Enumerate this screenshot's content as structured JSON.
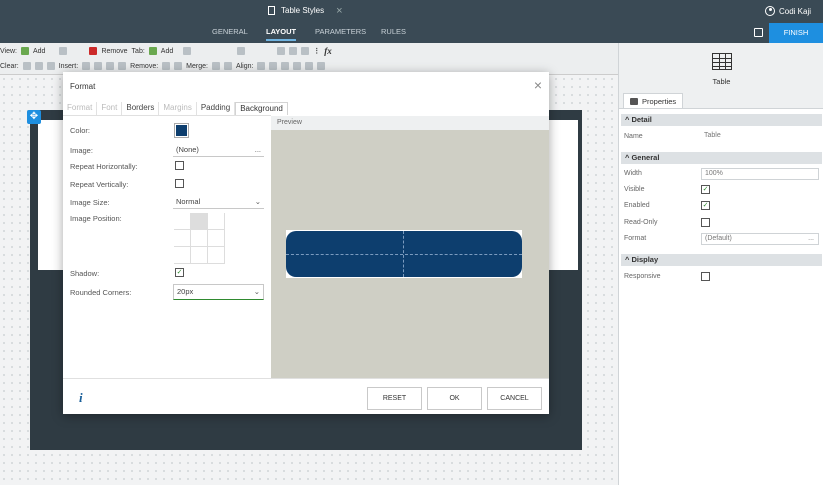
{
  "header": {
    "doc_title": "Table Styles",
    "user_name": "Codi Kaji",
    "tabs": [
      "GENERAL",
      "LAYOUT",
      "PARAMETERS",
      "RULES"
    ],
    "active_tab": "LAYOUT",
    "finish_label": "FINISH"
  },
  "toolbar": {
    "row1": {
      "view": "View:",
      "add": "Add",
      "remove": "Remove",
      "tab": "Tab:",
      "tab_add": "Add"
    },
    "row2": {
      "clear": "Clear:",
      "insert": "Insert:",
      "remove": "Remove:",
      "merge": "Merge:",
      "align": "Align:"
    }
  },
  "right_panel": {
    "control_label": "Table",
    "tab_label": "Properties",
    "sections": {
      "detail": "Detail",
      "general": "General",
      "display": "Display"
    },
    "properties": {
      "name_label": "Name",
      "name_value": "Table",
      "width_label": "Width",
      "width_value": "100%",
      "visible_label": "Visible",
      "visible_checked": true,
      "enabled_label": "Enabled",
      "enabled_checked": true,
      "readonly_label": "Read-Only",
      "readonly_checked": false,
      "format_label": "Format",
      "format_value": "(Default)",
      "format_more": "...",
      "responsive_label": "Responsive",
      "responsive_checked": false
    }
  },
  "dialog": {
    "title": "Format",
    "tabs": [
      "Format",
      "Font",
      "Borders",
      "Margins",
      "Padding",
      "Background"
    ],
    "selected_tab": "Background",
    "fields": {
      "color_label": "Color:",
      "color_value": "#0d3e6e",
      "image_label": "Image:",
      "image_value": "(None)",
      "image_more": "...",
      "repeat_h_label": "Repeat Horizontally:",
      "repeat_v_label": "Repeat Vertically:",
      "image_size_label": "Image Size:",
      "image_size_value": "Normal",
      "image_position_label": "Image Position:",
      "shadow_label": "Shadow:",
      "shadow_checked": true,
      "rounded_label": "Rounded Corners:",
      "rounded_value": "20px"
    },
    "preview_label": "Preview",
    "buttons": {
      "reset": "RESET",
      "ok": "OK",
      "cancel": "CANCEL"
    }
  },
  "icons": [
    "document-icon",
    "close-icon",
    "user-icon",
    "save-icon",
    "add-icon",
    "remove-icon",
    "function-icon",
    "table-icon",
    "properties-icon",
    "info-icon",
    "move-icon"
  ]
}
